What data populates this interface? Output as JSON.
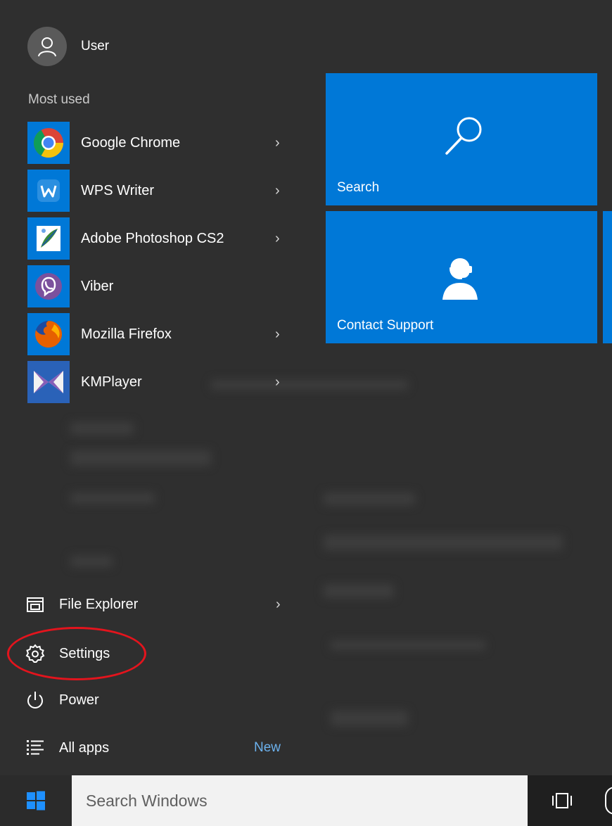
{
  "user": {
    "name": "User"
  },
  "most_used": {
    "label": "Most used",
    "apps": [
      {
        "label": "Google Chrome",
        "icon": "chrome-icon",
        "has_submenu": true
      },
      {
        "label": "WPS Writer",
        "icon": "wps-writer-icon",
        "has_submenu": true
      },
      {
        "label": "Adobe Photoshop CS2",
        "icon": "photoshop-icon",
        "has_submenu": true
      },
      {
        "label": "Viber",
        "icon": "viber-icon",
        "has_submenu": false
      },
      {
        "label": "Mozilla Firefox",
        "icon": "firefox-icon",
        "has_submenu": true
      },
      {
        "label": "KMPlayer",
        "icon": "kmplayer-icon",
        "has_submenu": true
      }
    ]
  },
  "bottom_items": {
    "file_explorer": {
      "label": "File Explorer",
      "icon": "file-explorer-icon"
    },
    "settings": {
      "label": "Settings",
      "icon": "gear-icon"
    },
    "power": {
      "label": "Power",
      "icon": "power-icon"
    },
    "all_apps": {
      "label": "All apps",
      "icon": "list-icon",
      "badge": "New"
    }
  },
  "tiles": {
    "search": {
      "label": "Search",
      "icon": "search-icon"
    },
    "contact_support": {
      "label": "Contact Support",
      "icon": "support-agent-icon"
    }
  },
  "taskbar": {
    "search_placeholder": "Search Windows",
    "start_icon": "windows-logo-icon",
    "task_view_icon": "task-view-icon"
  },
  "colors": {
    "menu_bg": "#2f2f2f",
    "accent": "#0078d7",
    "highlight": "#e3141d",
    "new_badge": "#6cb2ee"
  }
}
